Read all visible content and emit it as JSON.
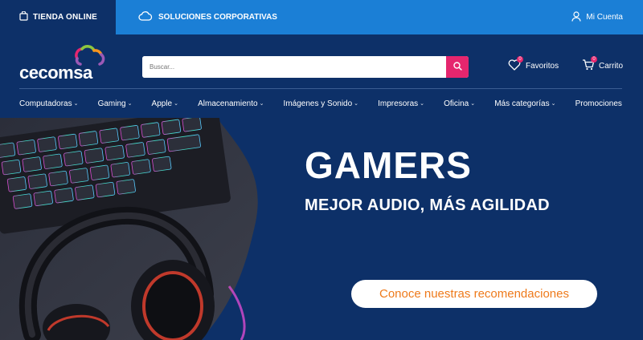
{
  "topbar": {
    "store_label": "TIENDA ONLINE",
    "corporate_label": "SOLUCIONES CORPORATIVAS",
    "account_label": "Mi Cuenta"
  },
  "header": {
    "logo_text": "cecomsa",
    "search_placeholder": "Buscar...",
    "favorites_label": "Favoritos",
    "favorites_count": "0",
    "cart_label": "Carrito",
    "cart_count": "0"
  },
  "nav": {
    "items": [
      {
        "label": "Computadoras",
        "has_dropdown": true
      },
      {
        "label": "Gaming",
        "has_dropdown": true
      },
      {
        "label": "Apple",
        "has_dropdown": true
      },
      {
        "label": "Almacenamiento",
        "has_dropdown": true
      },
      {
        "label": "Imágenes y Sonido",
        "has_dropdown": true
      },
      {
        "label": "Impresoras",
        "has_dropdown": true
      },
      {
        "label": "Oficina",
        "has_dropdown": true
      },
      {
        "label": "Más categorías",
        "has_dropdown": true
      },
      {
        "label": "Promociones",
        "has_dropdown": false
      }
    ]
  },
  "hero": {
    "title": "GAMERS",
    "subtitle": "MEJOR AUDIO, MÁS AGILIDAD",
    "cta_label": "Conoce nuestras recomendaciones"
  },
  "colors": {
    "navy": "#0d3068",
    "corporate_blue": "#1b7fd6",
    "accent_pink": "#e5266e",
    "cta_orange": "#ee7a1b"
  },
  "icons": [
    "store-bag-icon",
    "cloud-icon",
    "user-icon",
    "search-icon",
    "heart-icon",
    "cart-icon",
    "chevron-down-icon"
  ]
}
